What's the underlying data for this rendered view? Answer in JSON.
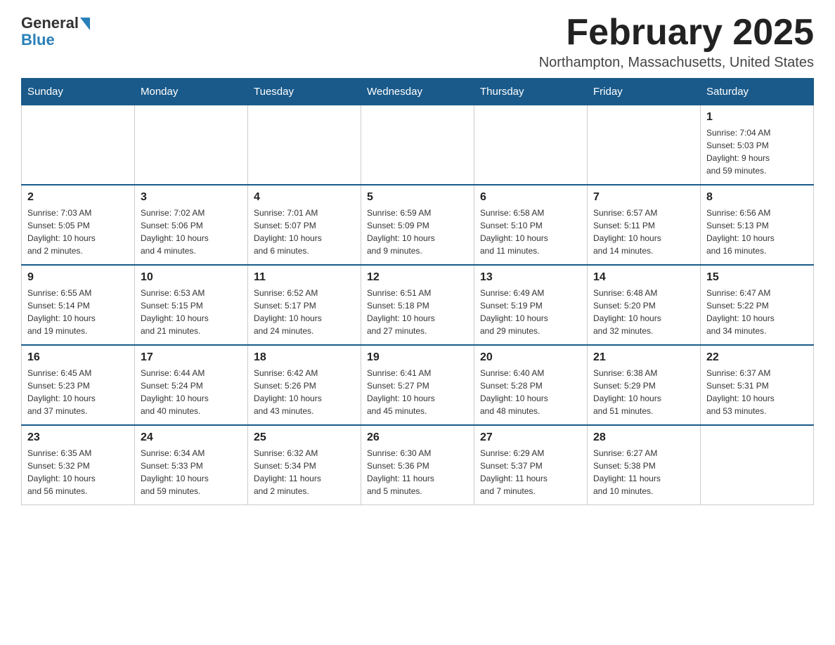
{
  "logo": {
    "general_text": "General",
    "blue_text": "Blue"
  },
  "title": "February 2025",
  "location": "Northampton, Massachusetts, United States",
  "weekdays": [
    "Sunday",
    "Monday",
    "Tuesday",
    "Wednesday",
    "Thursday",
    "Friday",
    "Saturday"
  ],
  "weeks": [
    [
      {
        "day": "",
        "info": ""
      },
      {
        "day": "",
        "info": ""
      },
      {
        "day": "",
        "info": ""
      },
      {
        "day": "",
        "info": ""
      },
      {
        "day": "",
        "info": ""
      },
      {
        "day": "",
        "info": ""
      },
      {
        "day": "1",
        "info": "Sunrise: 7:04 AM\nSunset: 5:03 PM\nDaylight: 9 hours\nand 59 minutes."
      }
    ],
    [
      {
        "day": "2",
        "info": "Sunrise: 7:03 AM\nSunset: 5:05 PM\nDaylight: 10 hours\nand 2 minutes."
      },
      {
        "day": "3",
        "info": "Sunrise: 7:02 AM\nSunset: 5:06 PM\nDaylight: 10 hours\nand 4 minutes."
      },
      {
        "day": "4",
        "info": "Sunrise: 7:01 AM\nSunset: 5:07 PM\nDaylight: 10 hours\nand 6 minutes."
      },
      {
        "day": "5",
        "info": "Sunrise: 6:59 AM\nSunset: 5:09 PM\nDaylight: 10 hours\nand 9 minutes."
      },
      {
        "day": "6",
        "info": "Sunrise: 6:58 AM\nSunset: 5:10 PM\nDaylight: 10 hours\nand 11 minutes."
      },
      {
        "day": "7",
        "info": "Sunrise: 6:57 AM\nSunset: 5:11 PM\nDaylight: 10 hours\nand 14 minutes."
      },
      {
        "day": "8",
        "info": "Sunrise: 6:56 AM\nSunset: 5:13 PM\nDaylight: 10 hours\nand 16 minutes."
      }
    ],
    [
      {
        "day": "9",
        "info": "Sunrise: 6:55 AM\nSunset: 5:14 PM\nDaylight: 10 hours\nand 19 minutes."
      },
      {
        "day": "10",
        "info": "Sunrise: 6:53 AM\nSunset: 5:15 PM\nDaylight: 10 hours\nand 21 minutes."
      },
      {
        "day": "11",
        "info": "Sunrise: 6:52 AM\nSunset: 5:17 PM\nDaylight: 10 hours\nand 24 minutes."
      },
      {
        "day": "12",
        "info": "Sunrise: 6:51 AM\nSunset: 5:18 PM\nDaylight: 10 hours\nand 27 minutes."
      },
      {
        "day": "13",
        "info": "Sunrise: 6:49 AM\nSunset: 5:19 PM\nDaylight: 10 hours\nand 29 minutes."
      },
      {
        "day": "14",
        "info": "Sunrise: 6:48 AM\nSunset: 5:20 PM\nDaylight: 10 hours\nand 32 minutes."
      },
      {
        "day": "15",
        "info": "Sunrise: 6:47 AM\nSunset: 5:22 PM\nDaylight: 10 hours\nand 34 minutes."
      }
    ],
    [
      {
        "day": "16",
        "info": "Sunrise: 6:45 AM\nSunset: 5:23 PM\nDaylight: 10 hours\nand 37 minutes."
      },
      {
        "day": "17",
        "info": "Sunrise: 6:44 AM\nSunset: 5:24 PM\nDaylight: 10 hours\nand 40 minutes."
      },
      {
        "day": "18",
        "info": "Sunrise: 6:42 AM\nSunset: 5:26 PM\nDaylight: 10 hours\nand 43 minutes."
      },
      {
        "day": "19",
        "info": "Sunrise: 6:41 AM\nSunset: 5:27 PM\nDaylight: 10 hours\nand 45 minutes."
      },
      {
        "day": "20",
        "info": "Sunrise: 6:40 AM\nSunset: 5:28 PM\nDaylight: 10 hours\nand 48 minutes."
      },
      {
        "day": "21",
        "info": "Sunrise: 6:38 AM\nSunset: 5:29 PM\nDaylight: 10 hours\nand 51 minutes."
      },
      {
        "day": "22",
        "info": "Sunrise: 6:37 AM\nSunset: 5:31 PM\nDaylight: 10 hours\nand 53 minutes."
      }
    ],
    [
      {
        "day": "23",
        "info": "Sunrise: 6:35 AM\nSunset: 5:32 PM\nDaylight: 10 hours\nand 56 minutes."
      },
      {
        "day": "24",
        "info": "Sunrise: 6:34 AM\nSunset: 5:33 PM\nDaylight: 10 hours\nand 59 minutes."
      },
      {
        "day": "25",
        "info": "Sunrise: 6:32 AM\nSunset: 5:34 PM\nDaylight: 11 hours\nand 2 minutes."
      },
      {
        "day": "26",
        "info": "Sunrise: 6:30 AM\nSunset: 5:36 PM\nDaylight: 11 hours\nand 5 minutes."
      },
      {
        "day": "27",
        "info": "Sunrise: 6:29 AM\nSunset: 5:37 PM\nDaylight: 11 hours\nand 7 minutes."
      },
      {
        "day": "28",
        "info": "Sunrise: 6:27 AM\nSunset: 5:38 PM\nDaylight: 11 hours\nand 10 minutes."
      },
      {
        "day": "",
        "info": ""
      }
    ]
  ]
}
